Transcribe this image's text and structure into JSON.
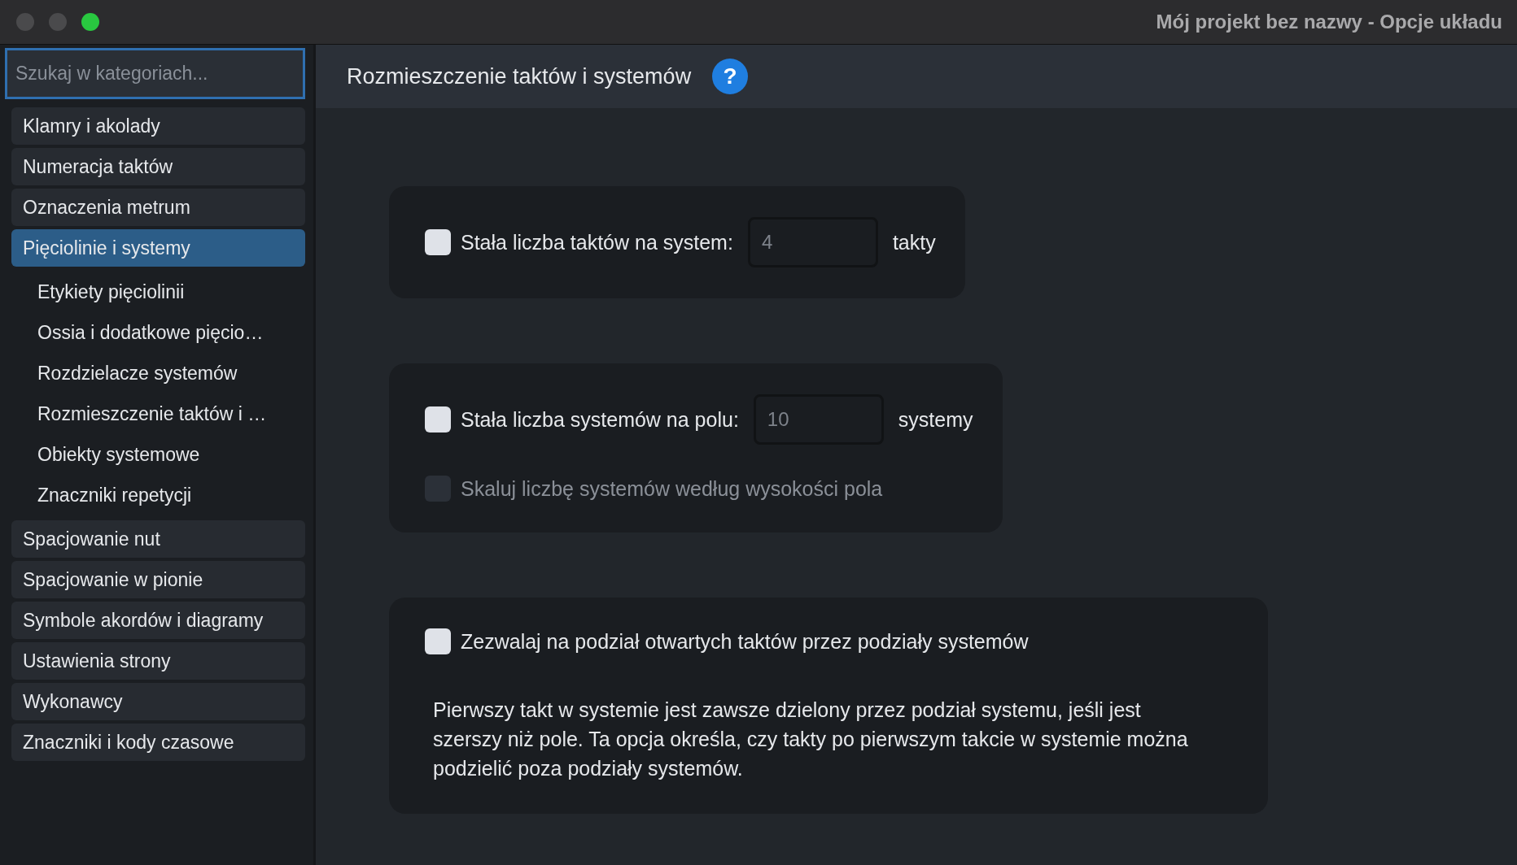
{
  "window": {
    "title": "Mój projekt bez nazwy - Opcje układu"
  },
  "sidebar": {
    "search": {
      "placeholder": "Szukaj w kategoriach..."
    },
    "items": [
      {
        "label": "Klamry i akolady",
        "selected": false
      },
      {
        "label": "Numeracja taktów",
        "selected": false
      },
      {
        "label": "Oznaczenia metrum",
        "selected": false
      },
      {
        "label": "Pięciolinie i systemy",
        "selected": true,
        "children": [
          {
            "label": "Etykiety pięciolinii",
            "selected": false
          },
          {
            "label": "Ossia i dodatkowe pięcio…",
            "selected": false
          },
          {
            "label": "Rozdzielacze systemów",
            "selected": false
          },
          {
            "label": "Rozmieszczenie taktów i …",
            "selected": false
          },
          {
            "label": "Obiekty systemowe",
            "selected": false
          },
          {
            "label": "Znaczniki repetycji",
            "selected": false
          }
        ]
      },
      {
        "label": "Spacjowanie nut",
        "selected": false
      },
      {
        "label": "Spacjowanie w pionie",
        "selected": false
      },
      {
        "label": "Symbole akordów i diagramy",
        "selected": false
      },
      {
        "label": "Ustawienia strony",
        "selected": false
      },
      {
        "label": "Wykonawcy",
        "selected": false
      },
      {
        "label": "Znaczniki i kody czasowe",
        "selected": false
      }
    ]
  },
  "header": {
    "title": "Rozmieszczenie taktów i systemów",
    "help": "?"
  },
  "panels": [
    {
      "options": [
        {
          "kind": "number",
          "label": "Stała liczba taktów na system:",
          "checked": false,
          "disabled": false,
          "value": "4",
          "field_disabled": true,
          "unit": "takty"
        }
      ]
    },
    {
      "options": [
        {
          "kind": "number",
          "label": "Stała liczba systemów na polu:",
          "checked": false,
          "disabled": false,
          "value": "10",
          "field_disabled": true,
          "unit": "systemy"
        },
        {
          "kind": "check",
          "label": "Skaluj liczbę systemów według wysokości pola",
          "checked": false,
          "disabled": true
        }
      ]
    },
    {
      "options": [
        {
          "kind": "check",
          "label": "Zezwalaj na podział otwartych taktów przez podziały systemów",
          "checked": false,
          "disabled": false
        }
      ],
      "description": "Pierwszy takt w systemie jest zawsze dzielony przez podział systemu, jeśli jest szerszy niż pole. Ta opcja określa, czy takty po pierwszym takcie w systemie można podzielić poza podziały systemów."
    }
  ]
}
